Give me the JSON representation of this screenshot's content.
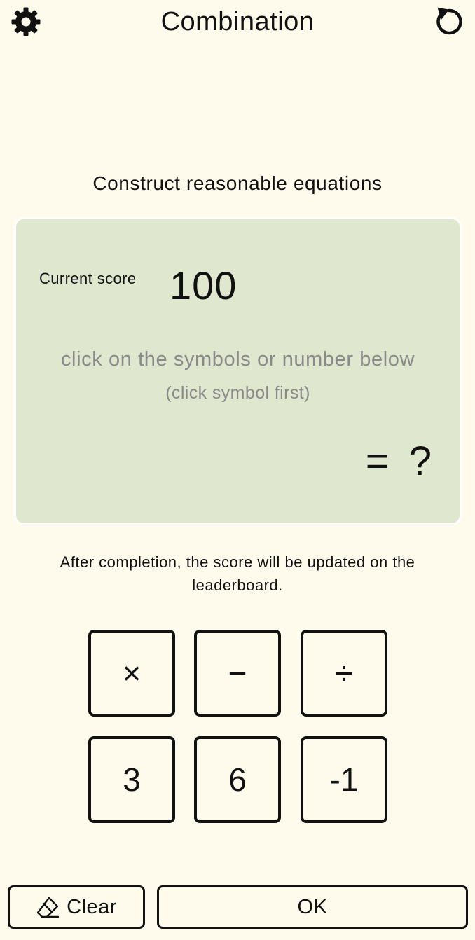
{
  "header": {
    "title": "Combination",
    "settings_icon": "gear-icon",
    "restart_icon": "restart-icon"
  },
  "instruction": "Construct reasonable equations",
  "panel": {
    "score_label": "Current score",
    "score_value": "100",
    "hint_main": "click on the symbols or number below",
    "hint_sub": "(click symbol first)",
    "result": "= ?",
    "background_color": "#dfe8cf"
  },
  "completion_note": "After completion, the score will be updated on the leaderboard.",
  "keypad": {
    "operators": [
      "×",
      "−",
      "÷"
    ],
    "numbers": [
      "3",
      "6",
      "-1"
    ]
  },
  "actions": {
    "clear_label": "Clear",
    "clear_icon": "eraser-icon",
    "ok_label": "OK"
  },
  "colors": {
    "background": "#fefbec",
    "panel": "#dfe8cf",
    "hint_text": "#8a8a8a"
  }
}
